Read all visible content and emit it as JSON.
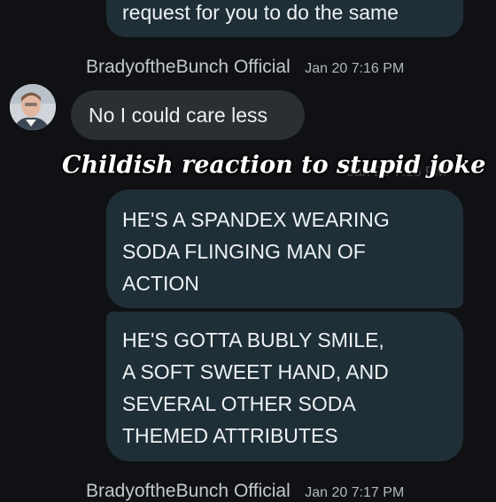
{
  "thread": {
    "top_bubble_text": "request for you to do the same",
    "group_1": {
      "sender": "BradyoftheBunch Official",
      "timestamp": "Jan 20 7:16 PM",
      "message": "No I could care less"
    },
    "caption": "Childish reaction to stupid joke",
    "obscured_timestamp": "Jan 20 7:16 PM",
    "outgoing": [
      {
        "lines": [
          "HE'S A SPANDEX WEARING",
          "SODA FLINGING MAN OF",
          "ACTION"
        ]
      },
      {
        "lines": [
          "HE'S GOTTA BUBLY SMILE,",
          "A SOFT SWEET HAND, AND",
          "SEVERAL OTHER SODA",
          "THEMED ATTRIBUTES"
        ]
      }
    ],
    "group_2": {
      "sender": "BradyoftheBunch Official",
      "timestamp": "Jan 20 7:17 PM"
    }
  },
  "colors": {
    "background": "#101114",
    "outgoing_bubble": "#1f2f38",
    "incoming_bubble": "#2b2e33",
    "caption_text": "#ffffff"
  },
  "icons": {
    "avatar": "profile-photo"
  }
}
